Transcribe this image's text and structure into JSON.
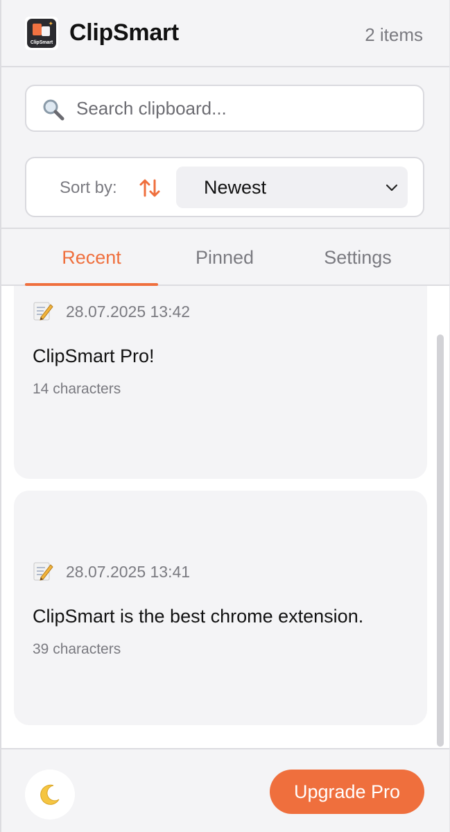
{
  "header": {
    "logo_text": "ClipSmart",
    "title": "ClipSmart",
    "item_count": "2 items"
  },
  "search": {
    "placeholder": "Search clipboard...",
    "value": "",
    "icon": "search-icon"
  },
  "sort": {
    "label": "Sort by:",
    "icon": "sort-arrows-icon",
    "selected": "Newest"
  },
  "tabs": [
    {
      "label": "Recent",
      "active": true
    },
    {
      "label": "Pinned",
      "active": false
    },
    {
      "label": "Settings",
      "active": false
    }
  ],
  "clipboard_items": [
    {
      "icon": "memo-icon",
      "timestamp": "28.07.2025 13:42",
      "text": "ClipSmart Pro!",
      "chars": "14 characters"
    },
    {
      "icon": "memo-icon",
      "timestamp": "28.07.2025 13:41",
      "text": "ClipSmart is the best chrome extension.",
      "chars": "39 characters"
    }
  ],
  "footer": {
    "theme_icon": "moon-icon",
    "upgrade_label": "Upgrade Pro"
  },
  "colors": {
    "accent": "#ef6f3d",
    "background": "#f4f4f6",
    "muted_text": "#7a7a80"
  }
}
